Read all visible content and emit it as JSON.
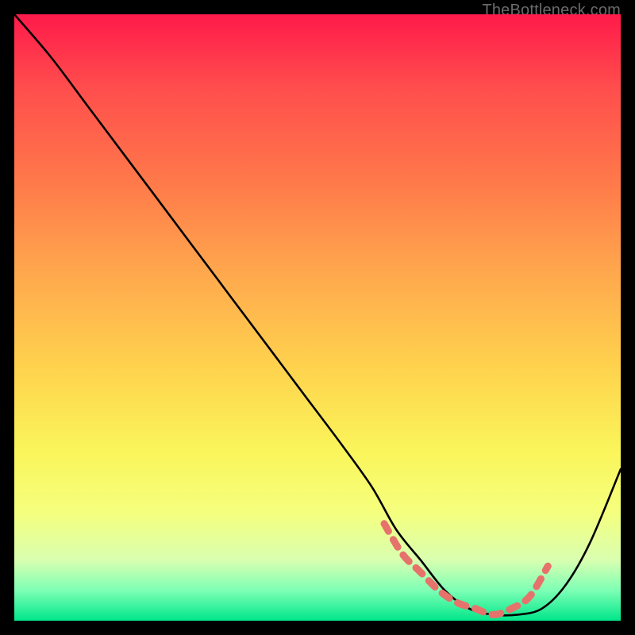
{
  "watermark": "TheBottleneck.com",
  "chart_data": {
    "type": "line",
    "title": "",
    "xlabel": "",
    "ylabel": "",
    "xlim": [
      0,
      100
    ],
    "ylim": [
      0,
      100
    ],
    "grid": false,
    "series": [
      {
        "name": "bottleneck-curve",
        "x": [
          0,
          6,
          12,
          18,
          24,
          30,
          36,
          42,
          48,
          54,
          59,
          63,
          67,
          71,
          75,
          79,
          83,
          87,
          91,
          95,
          100
        ],
        "y": [
          100,
          93,
          85,
          77,
          69,
          61,
          53,
          45,
          37,
          29,
          22,
          15,
          10,
          5,
          2,
          1,
          1,
          2,
          6,
          13,
          25
        ]
      }
    ],
    "highlighted_segment": {
      "name": "dashed-salmon-region",
      "x": [
        61,
        64,
        67,
        70,
        73,
        76,
        79,
        82,
        85,
        88
      ],
      "y": [
        16,
        11,
        8,
        5,
        3,
        2,
        1,
        2,
        4,
        9
      ]
    }
  }
}
